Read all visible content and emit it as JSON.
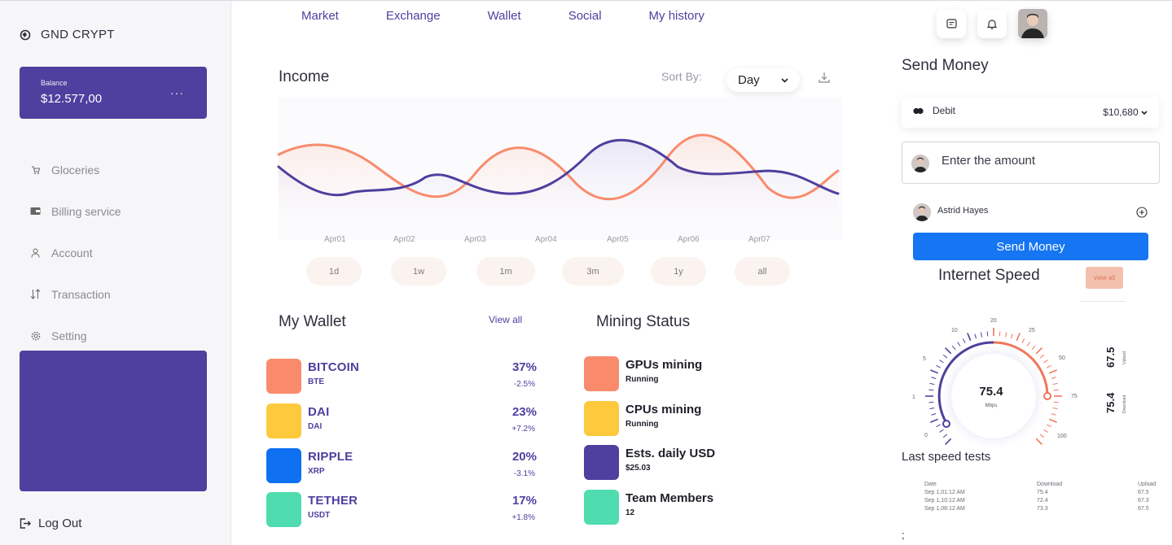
{
  "sidebar": {
    "brand": "GND CRYPT",
    "balance_label": "Balance",
    "balance_amount": "$12.577,00",
    "balance_more": "···",
    "items": [
      {
        "label": "Gloceries",
        "icon": "cart-icon"
      },
      {
        "label": "Billing service",
        "icon": "wallet-icon"
      },
      {
        "label": "Account",
        "icon": "user-icon"
      },
      {
        "label": "Transaction",
        "icon": "arrows-icon"
      },
      {
        "label": "Setting",
        "icon": "gear-icon"
      }
    ],
    "logout": "Log Out"
  },
  "topnav": [
    "Market",
    "Exchange",
    "Wallet",
    "Social",
    "My history"
  ],
  "income": {
    "title": "Income",
    "sort_label": "Sort By:",
    "sort_value": "Day",
    "dates": [
      "Apr01",
      "Apr02",
      "Apr03",
      "Apr04",
      "Apr05",
      "Apr06",
      "Apr07"
    ],
    "ranges": [
      "1d",
      "1w",
      "1m",
      "3m",
      "1y",
      "all"
    ]
  },
  "wallet": {
    "title": "My Wallet",
    "view_all": "View all",
    "items": [
      {
        "name": "BITCOIN",
        "symbol": "BTE",
        "pct": "37%",
        "change": "-2.5%",
        "color": "#f98b6c"
      },
      {
        "name": "DAI",
        "symbol": "DAI",
        "pct": "23%",
        "change": "+7.2%",
        "color": "#fdc93d"
      },
      {
        "name": "RIPPLE",
        "symbol": "XRP",
        "pct": "20%",
        "change": "-3.1%",
        "color": "#0f71f2"
      },
      {
        "name": "TETHER",
        "symbol": "USDT",
        "pct": "17%",
        "change": "+1.8%",
        "color": "#4fdcaf"
      }
    ]
  },
  "mining": {
    "title": "Mining Status",
    "items": [
      {
        "name": "GPUs mining",
        "sub": "Running",
        "color": "#f98b6c"
      },
      {
        "name": "CPUs mining",
        "sub": "Running",
        "color": "#fdc93d"
      },
      {
        "name": "Ests. daily USD",
        "sub": "$25.03",
        "color": "#4f3f9e"
      },
      {
        "name": "Team Members",
        "sub": "12",
        "color": "#4fdcaf"
      }
    ]
  },
  "send": {
    "title": "Send Money",
    "card_type": "Debit",
    "card_amount": "$10,680",
    "amount_placeholder": "Enter the amount",
    "recipient": "Astrid Hayes",
    "button": "Send Money"
  },
  "speed": {
    "title": "Internet Speed",
    "view_all": "view all",
    "value": "75.4",
    "unit": "Mbps",
    "ticks": [
      "0",
      "1",
      "5",
      "10",
      "20",
      "25",
      "50",
      "75",
      "100"
    ],
    "upload_value": "67.5",
    "upload_label": "Upload",
    "download_value": "75.4",
    "download_label": "Download",
    "last_title": "Last speed tests",
    "headers": [
      "Date",
      "Download",
      "Upload"
    ],
    "rows": [
      [
        "Sep 1,01:12 AM",
        "75.4",
        "67.5"
      ],
      [
        "Sep 1,10:12 AM",
        "72.4",
        "67.3"
      ],
      [
        "Sep 1,08:12 AM",
        "73.3",
        "67.5"
      ]
    ],
    "trailing": ";"
  },
  "colors": {
    "primary": "#4f3f9e",
    "accent": "#f98b6c",
    "button_blue": "#1575f2"
  }
}
